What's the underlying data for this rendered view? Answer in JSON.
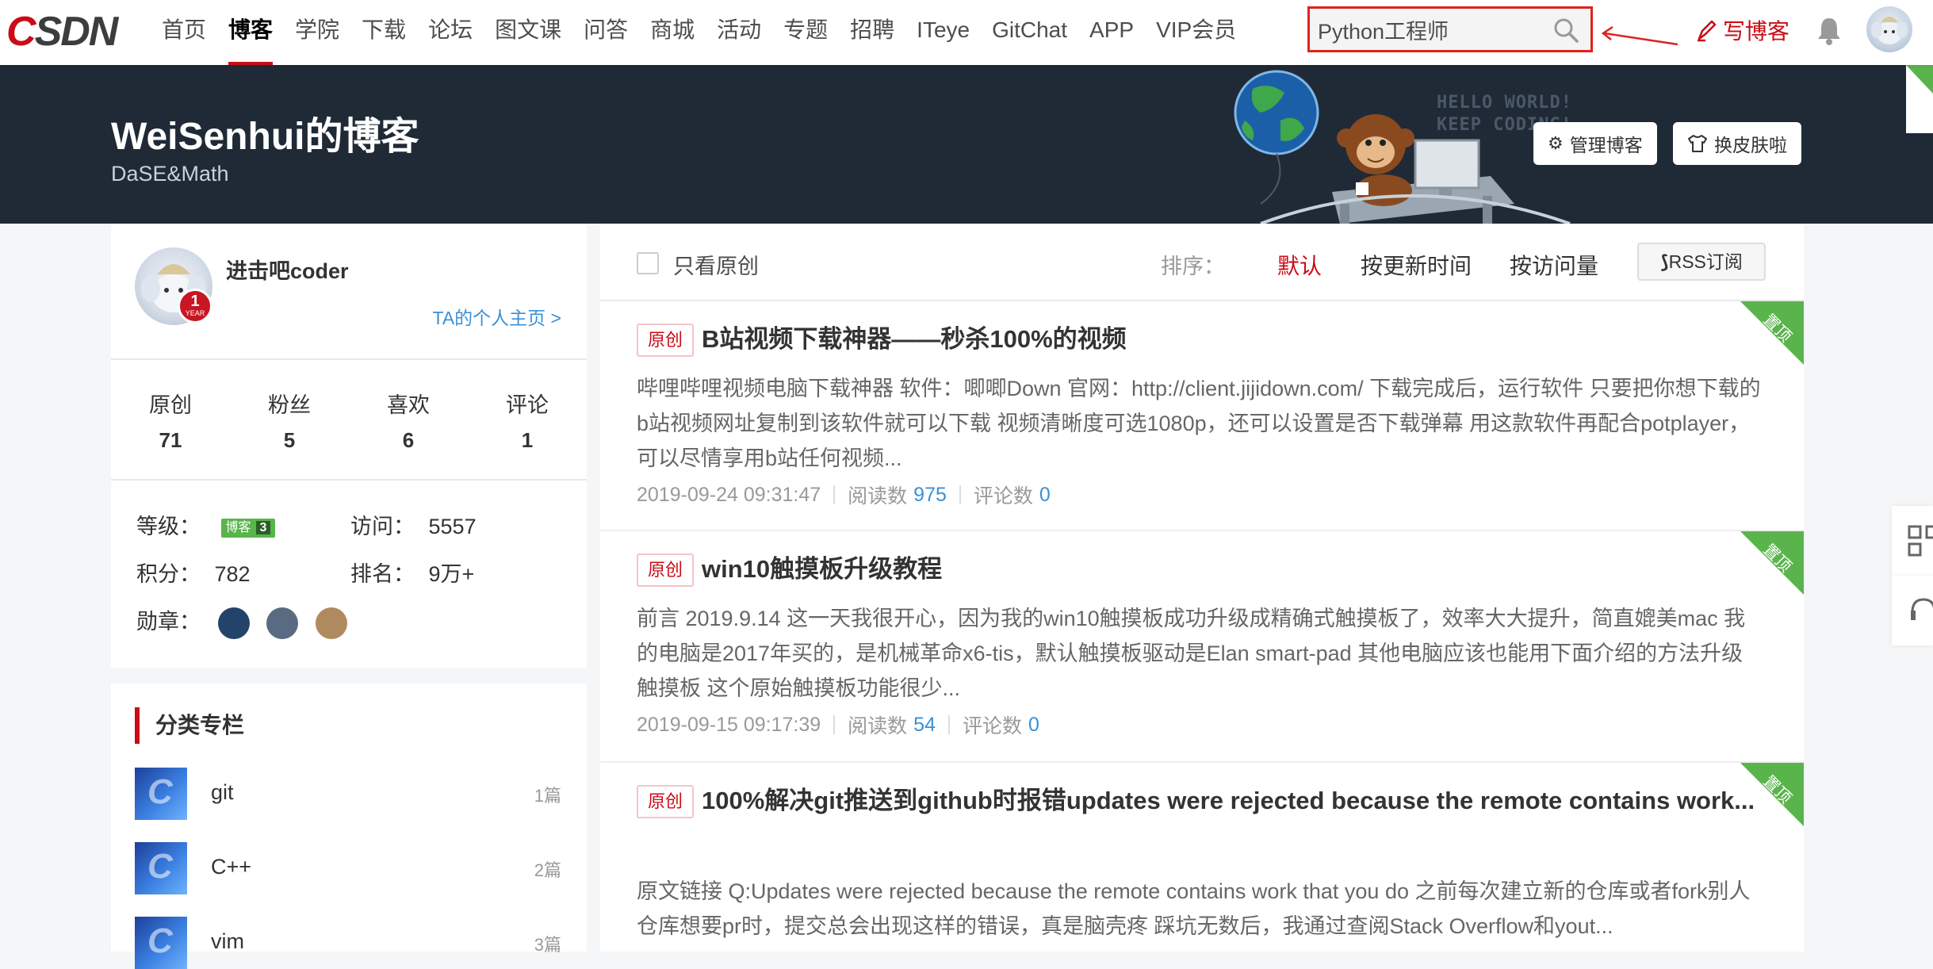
{
  "nav": {
    "logo": "CSDN",
    "items": [
      "首页",
      "博客",
      "学院",
      "下载",
      "论坛",
      "图文课",
      "问答",
      "商城",
      "活动",
      "专题",
      "招聘",
      "ITeye",
      "GitChat",
      "APP",
      "VIP会员"
    ],
    "active_index": 1,
    "search_value": "Python工程师",
    "write_label": "写博客"
  },
  "banner": {
    "title": "WeiSenhui的博客",
    "subtitle": "DaSE&Math",
    "hello_line1": "HELLO WORLD!",
    "hello_line2": "KEEP CODING!",
    "manage_label": "管理博客",
    "skin_label": "换皮肤啦"
  },
  "profile": {
    "username": "进击吧coder",
    "year_badge": "1",
    "year_text": "YEAR",
    "homepage_link": "TA的个人主页 >",
    "stats": [
      {
        "label": "原创",
        "value": "71"
      },
      {
        "label": "粉丝",
        "value": "5"
      },
      {
        "label": "喜欢",
        "value": "6"
      },
      {
        "label": "评论",
        "value": "1"
      }
    ],
    "level_label": "等级：",
    "level_badge": "博客",
    "level_num": "3",
    "visits_label": "访问：",
    "visits": "5557",
    "points_label": "积分：",
    "points": "782",
    "rank_label": "排名：",
    "rank": "9万+",
    "medals_label": "勋章："
  },
  "categories": {
    "title": "分类专栏",
    "items": [
      {
        "name": "git",
        "count": "1篇"
      },
      {
        "name": "C++",
        "count": "2篇"
      },
      {
        "name": "vim",
        "count": "3篇"
      }
    ]
  },
  "filter": {
    "only_original": "只看原创",
    "sort_label": "排序：",
    "sort_options": [
      "默认",
      "按更新时间",
      "按访问量"
    ],
    "rss": "RSS订阅"
  },
  "articles": [
    {
      "tag": "原创",
      "title": "B站视频下载神器——秒杀100%的视频",
      "desc": "哔哩哔哩视频电脑下载神器 软件：唧唧Down 官网：http://client.jijidown.com/ 下载完成后，运行软件 只要把你想下载的b站视频网址复制到该软件就可以下载 视频清晰度可选1080p，还可以设置是否下载弹幕 用这款软件再配合potplayer，可以尽情享用b站任何视频...",
      "date": "2019-09-24 09:31:47",
      "reads_label": "阅读数",
      "reads": "975",
      "comments_label": "评论数",
      "comments": "0",
      "ribbon": "置顶"
    },
    {
      "tag": "原创",
      "title": "win10触摸板升级教程",
      "desc": "前言 2019.9.14 这一天我很开心，因为我的win10触摸板成功升级成精确式触摸板了，效率大大提升，简直媲美mac 我的电脑是2017年买的，是机械革命x6-tis，默认触摸板驱动是Elan smart-pad 其他电脑应该也能用下面介绍的方法升级触摸板 这个原始触摸板功能很少...",
      "date": "2019-09-15 09:17:39",
      "reads_label": "阅读数",
      "reads": "54",
      "comments_label": "评论数",
      "comments": "0",
      "ribbon": "置顶"
    },
    {
      "tag": "原创",
      "title": "100%解决git推送到github时报错updates were rejected because the remote contains work...",
      "desc": "原文链接 Q:Updates were rejected because the remote contains work that you do 之前每次建立新的仓库或者fork别人仓库想要pr时，提交总会出现这样的错误，真是脑壳疼 踩坑无数后，我通过查阅Stack Overflow和yout...",
      "ribbon": "置顶"
    }
  ]
}
